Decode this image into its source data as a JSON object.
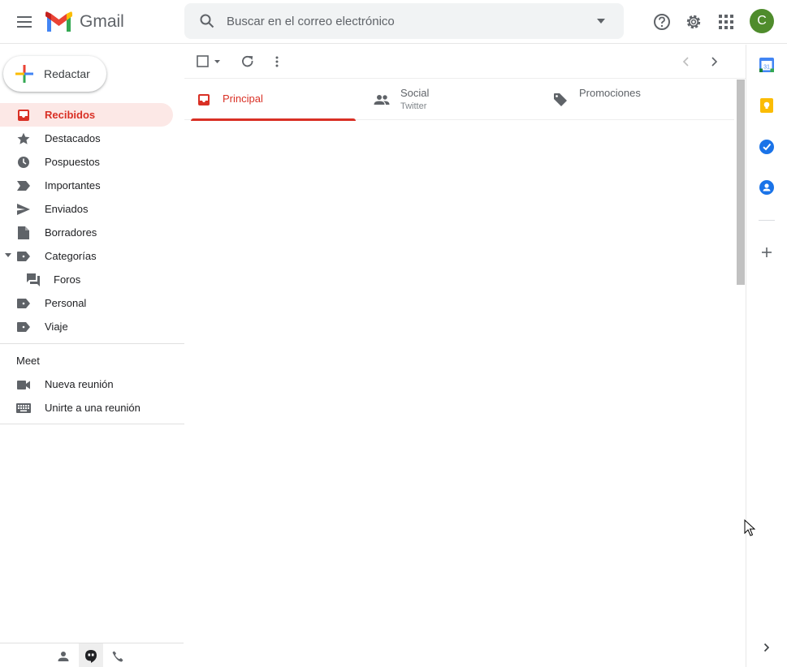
{
  "header": {
    "app_name": "Gmail",
    "search_placeholder": "Buscar en el correo electrónico",
    "avatar_letter": "C",
    "avatar_color": "#4f8c2c"
  },
  "sidebar": {
    "compose_label": "Redactar",
    "items": [
      {
        "label": "Recibidos",
        "icon": "inbox-icon",
        "active": true
      },
      {
        "label": "Destacados",
        "icon": "star-icon"
      },
      {
        "label": "Pospuestos",
        "icon": "clock-icon"
      },
      {
        "label": "Importantes",
        "icon": "important-icon"
      },
      {
        "label": "Enviados",
        "icon": "send-icon"
      },
      {
        "label": "Borradores",
        "icon": "draft-icon"
      },
      {
        "label": "Categorías",
        "icon": "label-icon"
      },
      {
        "label": "Foros",
        "icon": "forum-icon"
      },
      {
        "label": "Personal",
        "icon": "label-icon"
      },
      {
        "label": "Viaje",
        "icon": "label-icon"
      }
    ],
    "meet": {
      "title": "Meet",
      "items": [
        {
          "label": "Nueva reunión",
          "icon": "video-icon"
        },
        {
          "label": "Unirte a una reunión",
          "icon": "keyboard-icon"
        }
      ]
    }
  },
  "tabs": [
    {
      "label": "Principal",
      "sub": "",
      "icon": "inbox-icon",
      "active": true
    },
    {
      "label": "Social",
      "sub": "Twitter",
      "icon": "people-icon"
    },
    {
      "label": "Promociones",
      "sub": "",
      "icon": "tag-icon"
    }
  ],
  "colors": {
    "accent_red": "#d93025",
    "active_bg": "#fce8e6"
  }
}
